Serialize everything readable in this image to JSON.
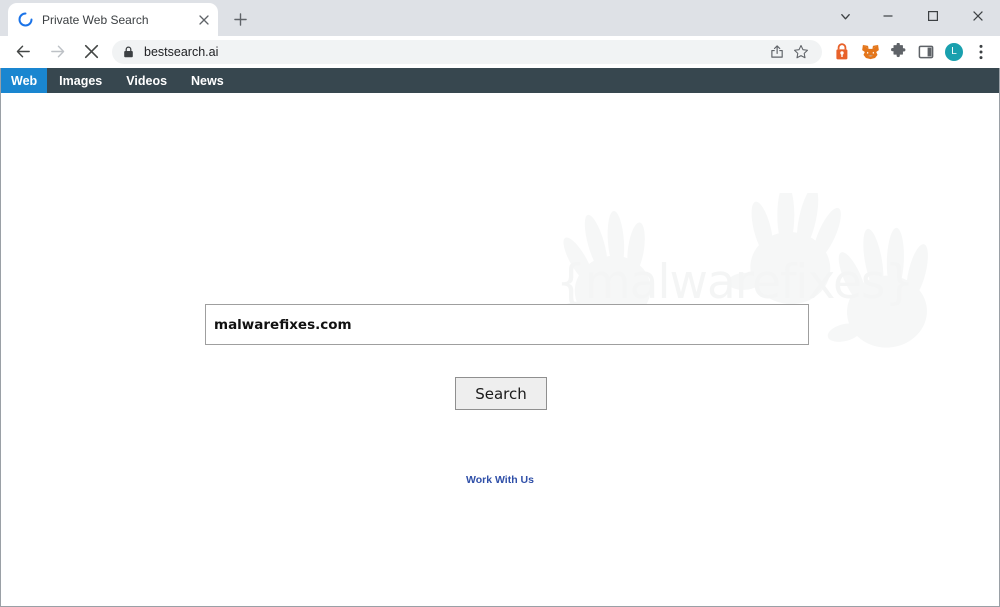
{
  "browser": {
    "tab": {
      "title": "Private Web Search",
      "loading": true,
      "close_label": "×",
      "favicon_icon": "loading-spinner-icon"
    },
    "new_tab_label": "+",
    "window_controls": {
      "tab_search_icon": "chevron-down-icon",
      "minimize_label": "–",
      "maximize_label": "☐",
      "close_label": "×"
    },
    "toolbar": {
      "back_icon": "back-arrow-icon",
      "forward_icon": "forward-arrow-icon",
      "stop_icon": "stop-loading-icon",
      "lock_icon": "lock-icon",
      "url": "bestsearch.ai",
      "share_icon": "share-icon",
      "bookmark_icon": "star-icon",
      "extensions": [
        {
          "name": "password-manager-extension-icon",
          "color": "#e8622b"
        },
        {
          "name": "metamask-fox-extension-icon",
          "color": "#e2761b"
        },
        {
          "name": "extensions-puzzle-icon",
          "color": "#5f6368"
        },
        {
          "name": "side-panel-icon",
          "color": "#5f6368"
        }
      ],
      "profile": {
        "initial": "L",
        "color": "#19a0ae"
      },
      "menu_icon": "three-dot-menu-icon"
    }
  },
  "site": {
    "nav": [
      {
        "label": "Web",
        "active": true
      },
      {
        "label": "Images",
        "active": false
      },
      {
        "label": "Videos",
        "active": false
      },
      {
        "label": "News",
        "active": false
      }
    ],
    "nav_bg": "#37474f",
    "nav_active_bg": "#1a86d0",
    "watermark_text": "{malwarefixes}",
    "search": {
      "value": "malwarefixes.com",
      "placeholder": "",
      "button_label": "Search"
    },
    "work_with_us_label": "Work With Us",
    "link_color": "#2f4fa8"
  }
}
